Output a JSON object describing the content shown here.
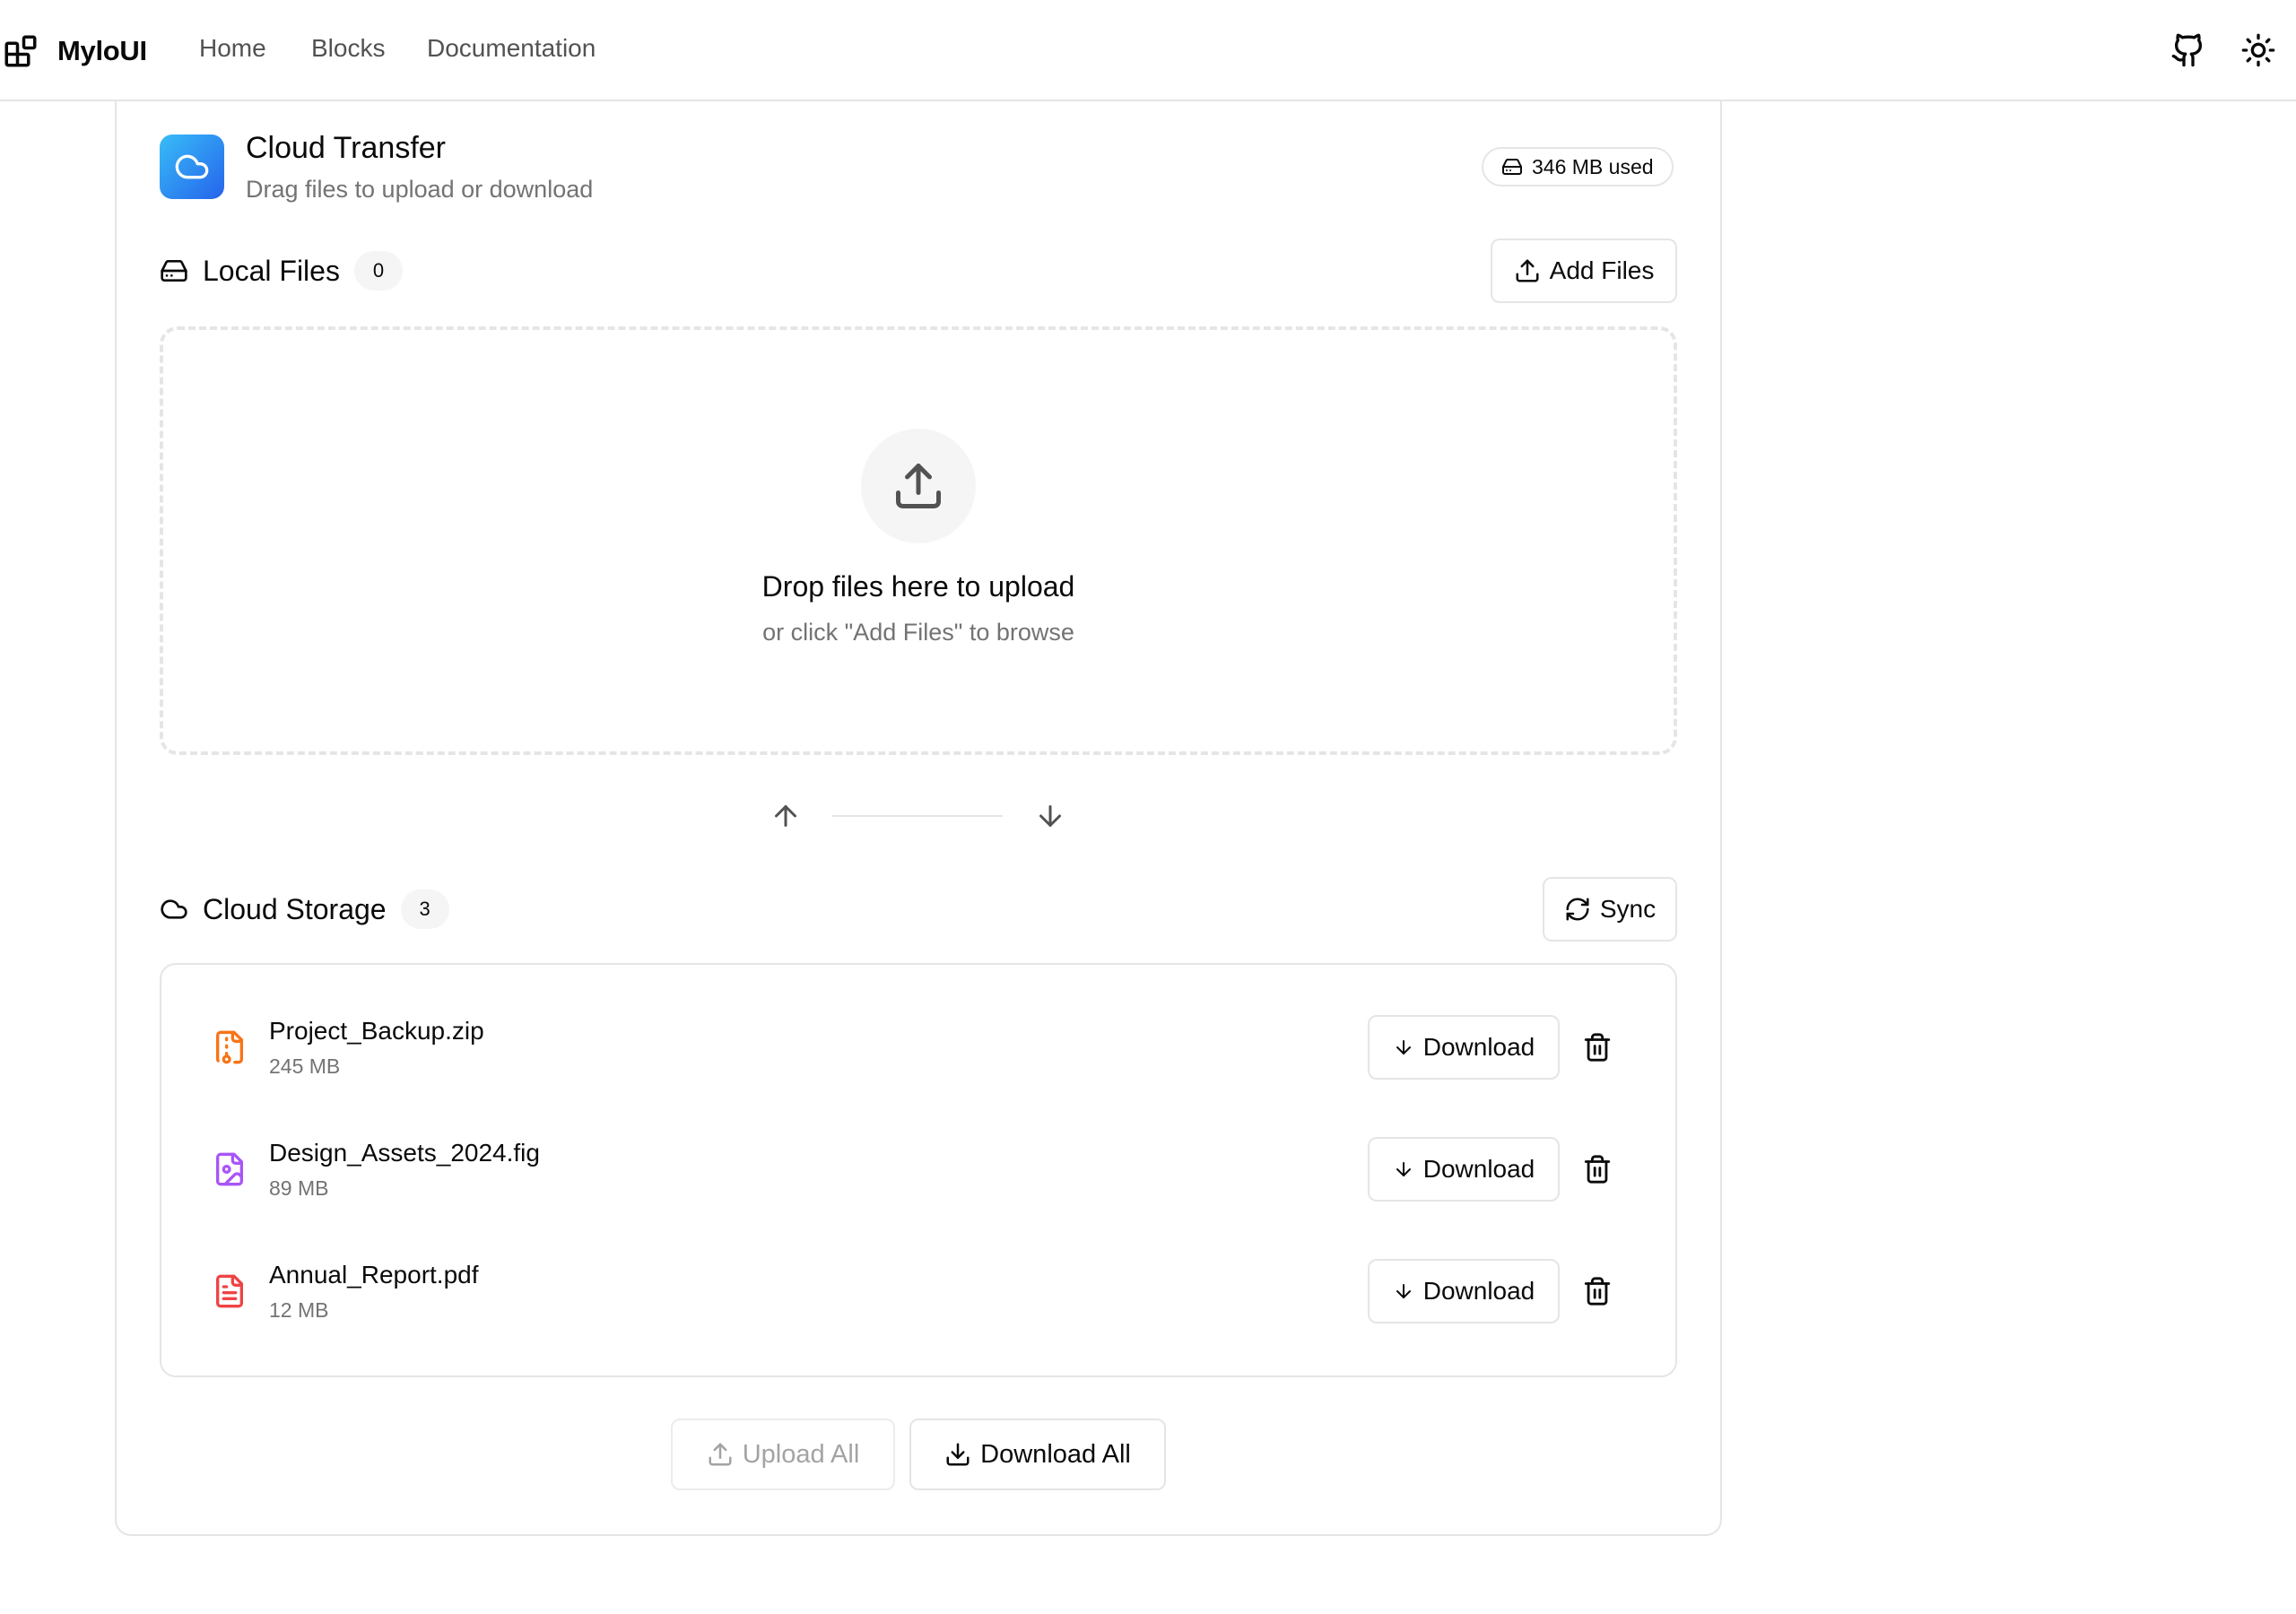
{
  "brand": {
    "name": "MyloUI"
  },
  "nav": {
    "home": "Home",
    "blocks": "Blocks",
    "docs": "Documentation"
  },
  "icons": {
    "github": "github-icon",
    "theme": "sun-icon"
  },
  "app": {
    "title": "Cloud Transfer",
    "subtitle": "Drag files to upload or download",
    "usage": "346 MB used",
    "accent": "#2563eb"
  },
  "local": {
    "title": "Local Files",
    "count": "0",
    "add_label": "Add Files",
    "drop_title": "Drop files here to upload",
    "drop_sub": "or click \"Add Files\" to browse"
  },
  "cloud": {
    "title": "Cloud Storage",
    "count": "3",
    "sync_label": "Sync",
    "files": [
      {
        "name": "Project_Backup.zip",
        "size": "245 MB",
        "icon": "file-archive-icon",
        "color": "#f97316",
        "download": "Download"
      },
      {
        "name": "Design_Assets_2024.fig",
        "size": "89 MB",
        "icon": "file-image-icon",
        "color": "#a855f7",
        "download": "Download"
      },
      {
        "name": "Annual_Report.pdf",
        "size": "12 MB",
        "icon": "file-text-icon",
        "color": "#ef4444",
        "download": "Download"
      }
    ]
  },
  "footer": {
    "upload_all": "Upload All",
    "download_all": "Download All"
  }
}
